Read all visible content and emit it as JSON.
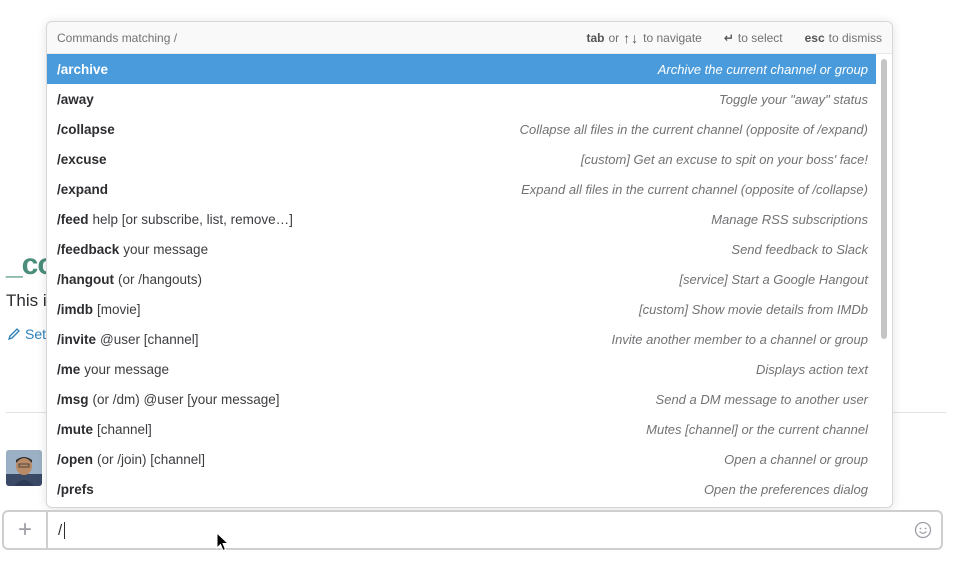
{
  "background": {
    "channel_title": "_co",
    "channel_desc": "This i",
    "set_link": "Set"
  },
  "popup": {
    "header": {
      "title": "Commands matching /",
      "tab_key": "tab",
      "or_text": "or",
      "arrow_keys": "↑↓",
      "navigate_text": "to navigate",
      "enter_key": "↵",
      "select_text": "to select",
      "esc_key": "esc",
      "dismiss_text": "to dismiss"
    },
    "commands": [
      {
        "cmd": "/archive",
        "args": "",
        "desc": "Archive the current channel or group"
      },
      {
        "cmd": "/away",
        "args": "",
        "desc": "Toggle your \"away\" status"
      },
      {
        "cmd": "/collapse",
        "args": "",
        "desc": "Collapse all files in the current channel (opposite of /expand)"
      },
      {
        "cmd": "/excuse",
        "args": "",
        "desc": "[custom] Get an excuse to spit on your boss' face!"
      },
      {
        "cmd": "/expand",
        "args": "",
        "desc": "Expand all files in the current channel (opposite of /collapse)"
      },
      {
        "cmd": "/feed",
        "args": "help [or subscribe, list, remove…]",
        "desc": "Manage RSS subscriptions"
      },
      {
        "cmd": "/feedback",
        "args": "your message",
        "desc": "Send feedback to Slack"
      },
      {
        "cmd": "/hangout",
        "args": "(or /hangouts)",
        "desc": "[service] Start a Google Hangout"
      },
      {
        "cmd": "/imdb",
        "args": "[movie]",
        "desc": "[custom] Show movie details from IMDb"
      },
      {
        "cmd": "/invite",
        "args": "@user [channel]",
        "desc": "Invite another member to a channel or group"
      },
      {
        "cmd": "/me",
        "args": "your message",
        "desc": "Displays action text"
      },
      {
        "cmd": "/msg",
        "args": "(or /dm) @user [your message]",
        "desc": "Send a DM message to another user"
      },
      {
        "cmd": "/mute",
        "args": "[channel]",
        "desc": "Mutes [channel] or the current channel"
      },
      {
        "cmd": "/open",
        "args": "(or /join) [channel]",
        "desc": "Open a channel or group"
      },
      {
        "cmd": "/prefs",
        "args": "",
        "desc": "Open the preferences dialog"
      }
    ]
  },
  "input": {
    "plus_label": "+",
    "value": "/"
  },
  "colors": {
    "selected_row": "#4a9bdb",
    "channel_title": "#4a8d7b",
    "link": "#2a80b9"
  }
}
